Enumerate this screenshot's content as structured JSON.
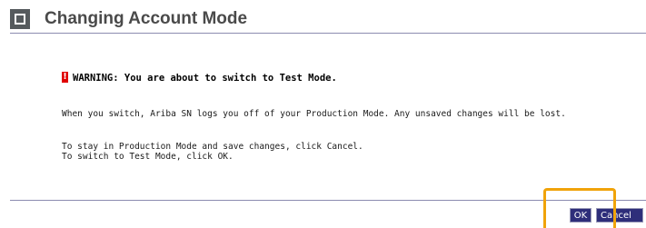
{
  "dialog": {
    "title": "Changing Account Mode",
    "warning": "WARNING: You are about to switch to Test Mode.",
    "warning_icon_symbol": "!",
    "message_1": "When you switch, Ariba SN logs you off of your Production Mode. Any unsaved changes will be lost.",
    "message_2": "To stay in Production Mode and save changes, click Cancel.",
    "message_3": "To switch to Test Mode, click OK."
  },
  "buttons": {
    "ok_label": "OK",
    "cancel_label": "Cancel"
  },
  "colors": {
    "header_icon": "#555a5d",
    "title_text": "#4a4a4a",
    "rule": "#8c8cb0",
    "warning_icon": "#e00000",
    "button_bg": "#2e2e7a",
    "highlight": "#f0a30a"
  },
  "icons": {
    "header": "window-square-icon",
    "warning": "warning-icon"
  }
}
